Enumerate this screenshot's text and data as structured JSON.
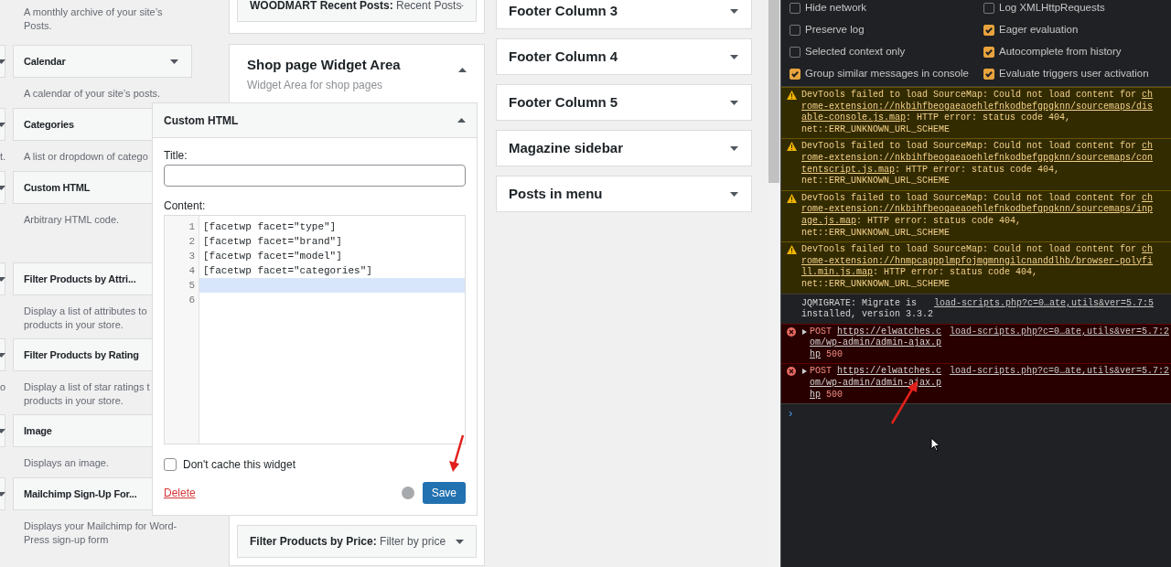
{
  "available_widgets": [
    {
      "description": [
        "A monthly archive of your site’s",
        "Posts."
      ]
    },
    {
      "title": "Calendar",
      "description": [
        "A calendar of your site’s posts."
      ]
    },
    {
      "title": "Categories",
      "left_fragment": "t.",
      "description": [
        "A list or dropdown of catego"
      ]
    },
    {
      "title": "Custom HTML",
      "description": [
        "Arbitrary HTML code."
      ]
    },
    {
      "title": "Filter Products by Attri...",
      "description": [
        "Display a list of attributes to",
        "products in your store."
      ]
    },
    {
      "title": "Filter Products by Rating",
      "left_fragment": "o",
      "description": [
        "Display a list of star ratings t",
        "products in your store."
      ]
    },
    {
      "title": "Image",
      "description": [
        "Displays an image."
      ]
    },
    {
      "title": "Mailchimp Sign-Up For...",
      "description": [
        "Displays your Mailchimp for Word-",
        "Press sign-up form"
      ]
    }
  ],
  "sidebar_top_widget": {
    "name": "WOODMART Recent Posts:",
    "title": "Recent Posts"
  },
  "shop_area": {
    "title": "Shop page Widget Area",
    "description": "Widget Area for shop pages",
    "open_widget": {
      "header": "Custom HTML",
      "title_label": "Title:",
      "content_label": "Content:",
      "code_lines": [
        {
          "number": "1",
          "text": "[facetwp facet=\"type\"]",
          "active": false
        },
        {
          "number": "2",
          "text": "[facetwp facet=\"brand\"]",
          "active": false
        },
        {
          "number": "3",
          "text": "[facetwp facet=\"model\"]",
          "active": false
        },
        {
          "number": "4",
          "text": "[facetwp facet=\"categories\"]",
          "active": false
        },
        {
          "number": "5",
          "active": true
        },
        {
          "number": "6",
          "active": false
        }
      ],
      "cache_option": {
        "label": "Don't cache this widget",
        "checked": false
      },
      "delete": "Delete",
      "save": "Save"
    },
    "widgets": [
      {
        "name": "Filter Products by Price:",
        "title": "Filter by price"
      }
    ]
  },
  "sidebars": [
    "Footer Column 3",
    "Footer Column 4",
    "Footer Column 5",
    "Magazine sidebar",
    "Posts in menu"
  ],
  "devtools": {
    "settings": [
      {
        "label": "Hide network",
        "checked": false
      },
      {
        "label": "Log XMLHttpRequests",
        "checked": false
      },
      {
        "label": "Preserve log",
        "checked": false
      },
      {
        "label": "Eager evaluation",
        "checked": true
      },
      {
        "label": "Selected context only",
        "checked": false
      },
      {
        "label": "Autocomplete from history",
        "checked": true
      },
      {
        "label": "Group similar messages in console",
        "checked": true
      },
      {
        "label": "Evaluate triggers user activation",
        "checked": true
      }
    ],
    "messages": [
      {
        "kind": "warning",
        "text": "DevTools failed to load SourceMap: Could not load content for ",
        "link": "chrome-extension://nkbihfbeogaeaoehlefnkodbefgpgknn/sourcemaps/disable-console.js.map",
        "after": ": HTTP error: status code 404, net::ERR_UNKNOWN_URL_SCHEME"
      },
      {
        "kind": "warning",
        "text": "DevTools failed to load SourceMap: Could not load content for ",
        "link": "chrome-extension://nkbihfbeogaeaoehlefnkodbefgpgknn/sourcemaps/contentscript.js.map",
        "after": ": HTTP error: status code 404, net::ERR_UNKNOWN_URL_SCHEME"
      },
      {
        "kind": "warning",
        "text": "DevTools failed to load SourceMap: Could not load content for ",
        "link": "chrome-extension://nkbihfbeogaeaoehlefnkodbefgpgknn/sourcemaps/inpage.js.map",
        "after": ": HTTP error: status code 404, net::ERR_UNKNOWN_URL_SCHEME"
      },
      {
        "kind": "warning",
        "text": "DevTools failed to load SourceMap: Could not load content for ",
        "link": "chrome-extension://hnmpcagpplmpfojmgmnngilcnanddlhb/browser-polyfill.min.js.map",
        "after": ": HTTP error: status code 404, net::ERR_UNKNOWN_URL_SCHEME"
      },
      {
        "kind": "info",
        "text": "JQMIGRATE: Migrate is installed, version 3.3.2",
        "source": "load-scripts.php?c=0…ate,utils&ver=5.7:5"
      },
      {
        "kind": "error",
        "method": "POST",
        "url": "https://elwatches.com/wp-admin/admin-ajax.php",
        "status": "500",
        "source": "load-scripts.php?c=0…ate,utils&ver=5.7:2"
      },
      {
        "kind": "error",
        "method": "POST",
        "url": "https://elwatches.com/wp-admin/admin-ajax.php",
        "status": "500",
        "source": "load-scripts.php?c=0…ate,utils&ver=5.7:2"
      }
    ],
    "prompt": "›"
  }
}
